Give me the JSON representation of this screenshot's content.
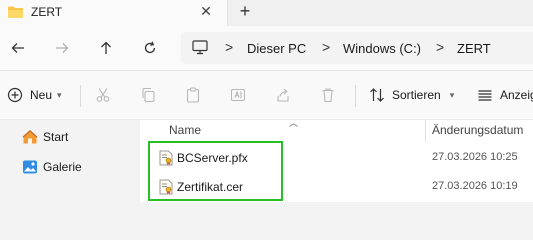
{
  "tab": {
    "title": "ZERT",
    "close_glyph": "✕",
    "new_glyph": "+"
  },
  "nav": {
    "back_icon": "arrow-left-icon",
    "forward_icon": "arrow-right-icon",
    "up_icon": "arrow-up-icon",
    "refresh_icon": "refresh-icon"
  },
  "address": {
    "crumbs": [
      "Dieser PC",
      "Windows (C:)",
      "ZERT"
    ],
    "separator": ">"
  },
  "commands": {
    "new_label": "Neu",
    "sort_label": "Sortieren",
    "view_label": "Anzeig"
  },
  "sidebar": {
    "items": [
      {
        "label": "Start",
        "icon": "home-icon"
      },
      {
        "label": "Galerie",
        "icon": "gallery-icon"
      }
    ]
  },
  "columns": {
    "name": "Name",
    "date": "Änderungsdatum"
  },
  "files": [
    {
      "name": "BCServer.pfx",
      "date": "27.03.2026 10:25",
      "icon": "certificate-file-icon"
    },
    {
      "name": "Zertifikat.cer",
      "date": "27.03.2026 10:19",
      "icon": "certificate-file-icon"
    }
  ],
  "colors": {
    "highlight": "#26c026",
    "accent": "#0067c0"
  }
}
